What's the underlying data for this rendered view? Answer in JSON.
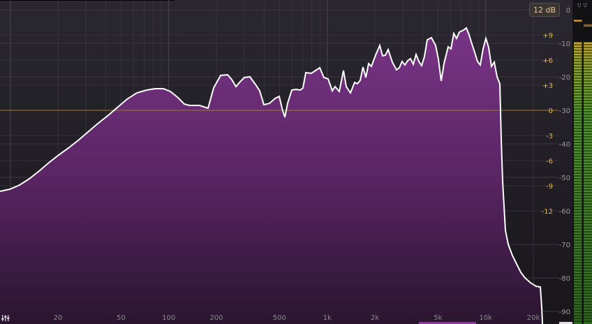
{
  "range_button": {
    "label": "12 dB"
  },
  "peak_readout": "0.0",
  "eq_scale_labels": [
    "+9",
    "+6",
    "+3",
    "0",
    "-3",
    "-6",
    "-9",
    "-12"
  ],
  "db_scale_labels": [
    "0",
    "-10",
    "-20",
    "-30",
    "-40",
    "-50",
    "-60",
    "-70",
    "-80",
    "-90"
  ],
  "freq_labels": [
    "20",
    "50",
    "100",
    "200",
    "500",
    "1k",
    "2k",
    "5k",
    "10k",
    "20k"
  ],
  "meter": {
    "left_level": 0.87,
    "right_level": 0.87,
    "left_peak": 0.94,
    "right_peak": 0.925
  },
  "colors": {
    "spectrum_fill": "#6b2d77",
    "spectrum_line": "#ffffff",
    "eq_label": "#e9b840",
    "zero_line": "#9a7a3a",
    "meter_green": "#3c8f24"
  },
  "icons": {
    "settings": "settings-icon"
  }
}
